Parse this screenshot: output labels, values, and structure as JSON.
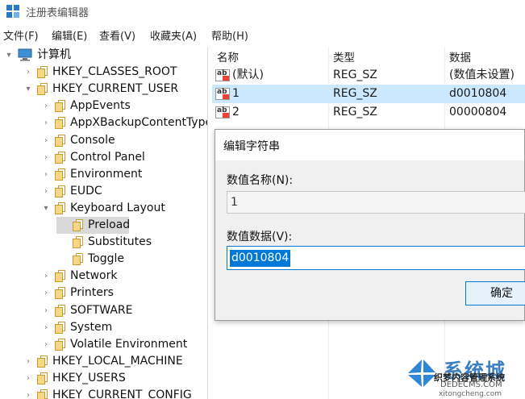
{
  "window": {
    "title": "注册表编辑器"
  },
  "menu": [
    "文件(F)",
    "编辑(E)",
    "查看(V)",
    "收藏夹(A)",
    "帮助(H)"
  ],
  "tree": {
    "root": "计算机",
    "items": [
      {
        "label": "HKEY_CLASSES_ROOT",
        "expanded": false
      },
      {
        "label": "HKEY_CURRENT_USER",
        "expanded": true
      },
      {
        "label": "AppEvents",
        "expanded": false
      },
      {
        "label": "AppXBackupContentType",
        "expanded": false
      },
      {
        "label": "Console",
        "expanded": false
      },
      {
        "label": "Control Panel",
        "expanded": false
      },
      {
        "label": "Environment",
        "expanded": false
      },
      {
        "label": "EUDC",
        "expanded": false
      },
      {
        "label": "Keyboard Layout",
        "expanded": true
      },
      {
        "label": "Preload",
        "selected": true
      },
      {
        "label": "Substitutes"
      },
      {
        "label": "Toggle"
      },
      {
        "label": "Network",
        "expanded": false
      },
      {
        "label": "Printers",
        "expanded": false
      },
      {
        "label": "SOFTWARE",
        "expanded": false
      },
      {
        "label": "System",
        "expanded": false
      },
      {
        "label": "Volatile Environment",
        "expanded": false
      },
      {
        "label": "HKEY_LOCAL_MACHINE",
        "expanded": false
      },
      {
        "label": "HKEY_USERS",
        "expanded": false
      },
      {
        "label": "HKEY_CURRENT_CONFIG",
        "expanded": false
      }
    ]
  },
  "list": {
    "columns": [
      "名称",
      "类型",
      "数据"
    ],
    "rows": [
      {
        "name": "(默认)",
        "type": "REG_SZ",
        "data": "(数值未设置)"
      },
      {
        "name": "1",
        "type": "REG_SZ",
        "data": "d0010804",
        "selected": true
      },
      {
        "name": "2",
        "type": "REG_SZ",
        "data": "00000804"
      }
    ]
  },
  "dialog": {
    "title": "编辑字符串",
    "name_label": "数值名称(N):",
    "name_value": "1",
    "data_label": "数值数据(V):",
    "data_value": "d0010804",
    "ok_label": "确定"
  },
  "watermark": {
    "brand": "系统城",
    "line1": "织梦内容管理系统",
    "line2": "DEDECMS.COM",
    "line3": "xitongcheng.com"
  },
  "colors": {
    "selection_blue": "#0078d7",
    "row_highlight": "#cce8ff",
    "folder_yellow": "#f5d78a"
  }
}
